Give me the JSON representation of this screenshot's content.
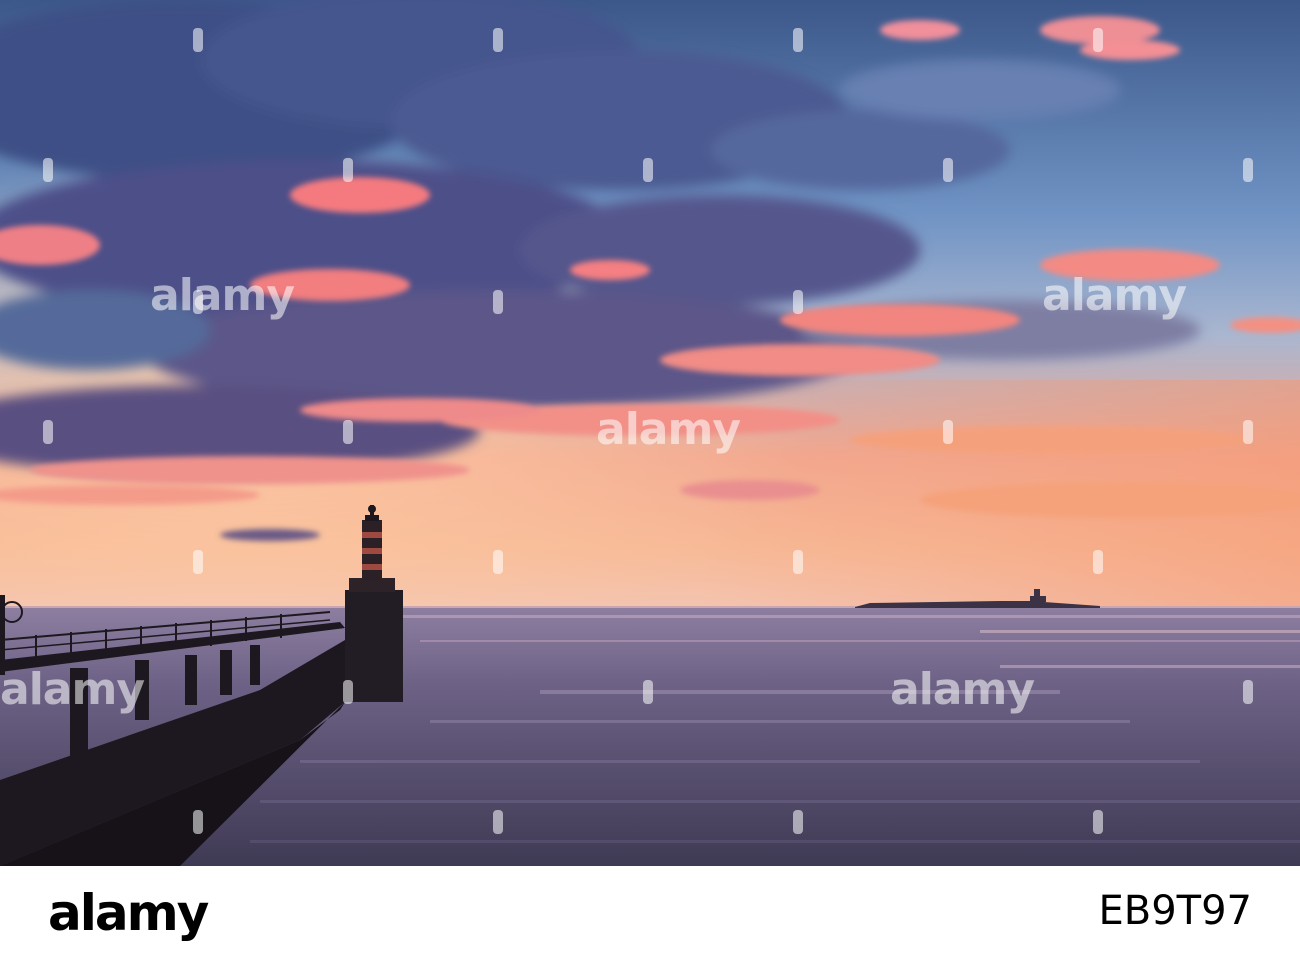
{
  "scene": {
    "subject": "sunset seascape with harbour pier lighthouse and distant island",
    "colors": {
      "sky_top": "#3f5b8c",
      "sky_mid": "#7fa8d2",
      "sky_glow": "#f3a37c",
      "horizon": "#f6c3a0",
      "cloud_dark": "#4d4f84",
      "cloud_pink": "#f36e78",
      "sea": "#5b5372",
      "sea_highlight": "#b79ab8",
      "silhouette": "#1d1820"
    }
  },
  "watermark": {
    "text": "alamy"
  },
  "footer": {
    "logo": "alamy",
    "image_id": "EB9T97"
  }
}
